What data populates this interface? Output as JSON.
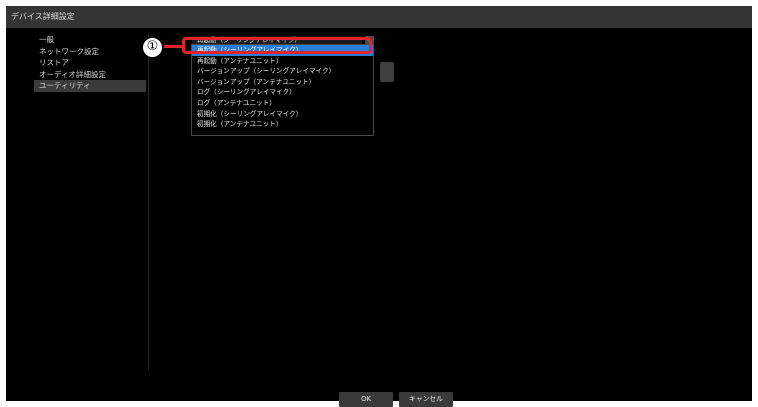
{
  "window": {
    "title": "デバイス詳細設定"
  },
  "sidebar": {
    "items": [
      {
        "label": "一般"
      },
      {
        "label": "ネットワーク設定"
      },
      {
        "label": "リストア"
      },
      {
        "label": "オーディオ詳細設定"
      },
      {
        "label": "ユーティリティ",
        "selected": true
      }
    ]
  },
  "utility": {
    "select_value": "再起動（シーリングアレイマイク）",
    "options": [
      "再起動（シーリングアレイマイク）",
      "再起動（アンテナユニット）",
      "バージョンアップ（シーリングアレイマイク）",
      "バージョンアップ（アンテナユニット）",
      "ログ（シーリングアレイマイク）",
      "ログ（アンテナユニット）",
      "初期化（シーリングアレイマイク）",
      "初期化（アンテナユニット）"
    ],
    "selected_index": 0
  },
  "annotation": {
    "callout": "①",
    "color": "#e2232a"
  },
  "footer": {
    "ok_label": "OK",
    "cancel_label": "キャンセル"
  },
  "colors": {
    "accent": "#2a7dd8",
    "background": "#000000",
    "panel": "#343434"
  }
}
